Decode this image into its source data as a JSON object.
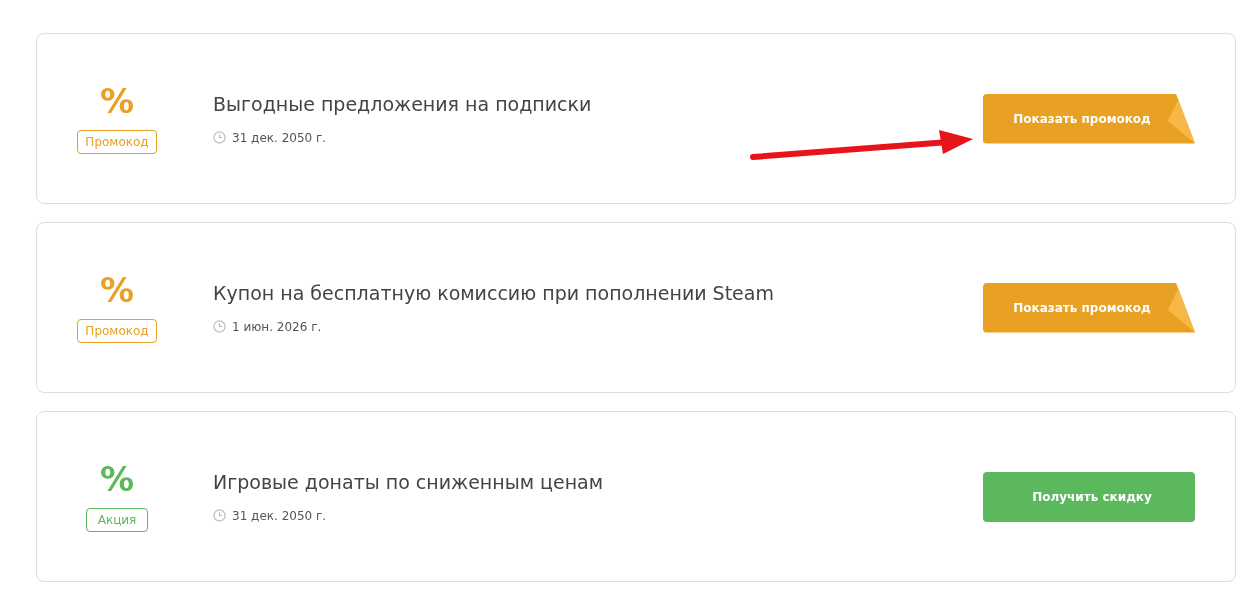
{
  "offers": [
    {
      "kind": "promo",
      "symbol": "%",
      "badge": "Промокод",
      "title": "Выгодные предложения на подписки",
      "date": "31 дек. 2050 г.",
      "button": "Показать промокод",
      "arrow": true
    },
    {
      "kind": "promo",
      "symbol": "%",
      "badge": "Промокод",
      "title": "Купон на бесплатную комиссию при пополнении Steam",
      "date": "1 июн. 2026 г.",
      "button": "Показать промокод",
      "arrow": false
    },
    {
      "kind": "sale",
      "symbol": "%",
      "badge": "Акция",
      "title": "Игровые донаты по сниженным ценам",
      "date": "31 дек. 2050 г.",
      "button": "Получить скидку",
      "arrow": false
    }
  ]
}
